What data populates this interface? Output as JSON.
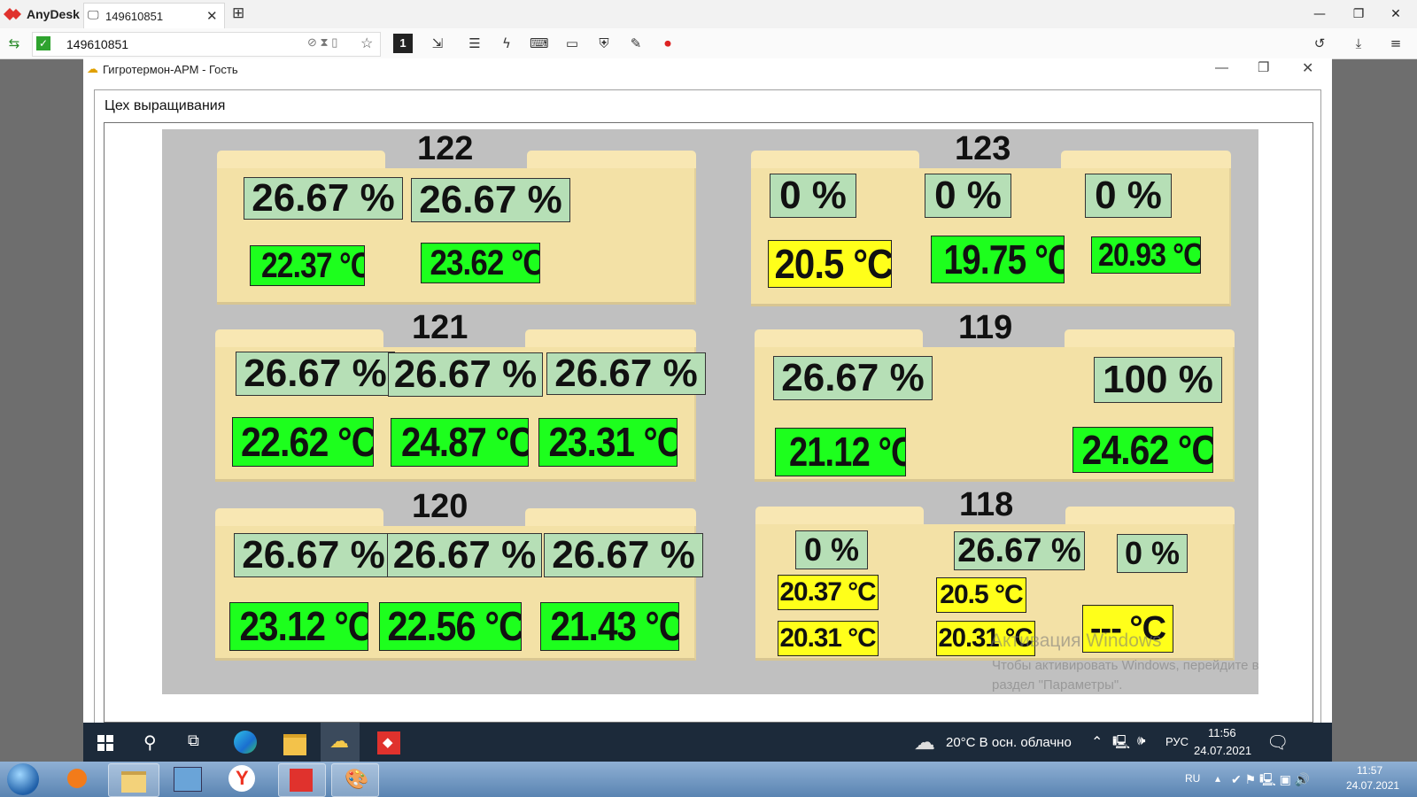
{
  "anydesk": {
    "app_name": "AnyDesk",
    "tab_label": "149610851",
    "address_value": "149610851",
    "toolbar_monitor": "1"
  },
  "remote_window": {
    "title": "Гигротермон-АРМ - Гость",
    "group_title": "Цех выращивания"
  },
  "rooms": [
    {
      "number": "122",
      "humidity": [
        "26.67 %",
        "26.67 %"
      ],
      "temps": [
        "22.37 °C",
        "23.62 °C"
      ]
    },
    {
      "number": "123",
      "humidity": [
        "0 %",
        "0 %",
        "0 %"
      ],
      "temps": [
        "20.5 °C",
        "19.75 °C",
        "20.93 °C"
      ]
    },
    {
      "number": "121",
      "humidity": [
        "26.67 %",
        "26.67 %",
        "26.67 %"
      ],
      "temps": [
        "22.62 °C",
        "24.87 °C",
        "23.31 °C"
      ]
    },
    {
      "number": "119",
      "humidity": [
        "26.67 %",
        "100 %"
      ],
      "temps": [
        "21.12 °C",
        "24.62 °C"
      ]
    },
    {
      "number": "120",
      "humidity": [
        "26.67 %",
        "26.67 %",
        "26.67 %"
      ],
      "temps": [
        "23.12 °C",
        "22.56 °C",
        "21.43 °C"
      ]
    },
    {
      "number": "118",
      "humidity": [
        "0 %",
        "26.67 %",
        "0 %"
      ],
      "temps": [
        "20.37 °C",
        "20.5 °C",
        "20.31 °C",
        "20.31 °C",
        "--- °C"
      ]
    }
  ],
  "colors": {
    "temp_ok": "#1dff1d",
    "temp_warn": "#ffff1a",
    "humidity_bg": "#b6dfb6",
    "folder": "#f3e1a6"
  },
  "win10_taskbar": {
    "weather": "20°C  В осн. облачно",
    "lang": "РУС",
    "time": "11:56",
    "date": "24.07.2021"
  },
  "watermark": {
    "title": "Активация Windows",
    "line1": "Чтобы активировать Windows, перейдите в",
    "line2": "раздел \"Параметры\"."
  },
  "win7_taskbar": {
    "lang": "RU",
    "time": "11:57",
    "date": "24.07.2021"
  }
}
